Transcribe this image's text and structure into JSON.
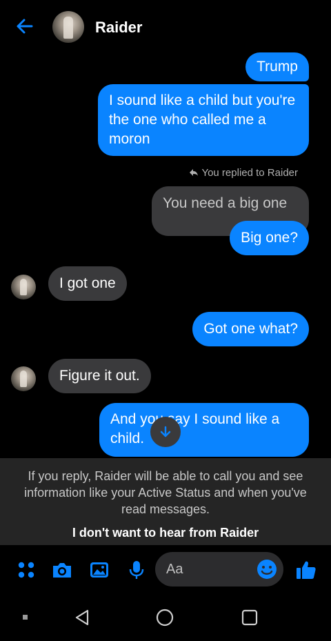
{
  "header": {
    "contact_name": "Raider",
    "back_icon": "arrow-left-icon"
  },
  "messages": [
    {
      "side": "out",
      "text": "Trump"
    },
    {
      "side": "out",
      "text": "I sound like a child but you're the one who called me a moron"
    },
    {
      "type": "reply-note",
      "text": "You replied to Raider"
    },
    {
      "side": "quoted",
      "text": "You need a big one"
    },
    {
      "side": "out",
      "text": "Big one?"
    },
    {
      "side": "in",
      "text": "I got one"
    },
    {
      "side": "out",
      "text": "Got one what?"
    },
    {
      "side": "in",
      "text": "Figure it out."
    },
    {
      "side": "out",
      "text": "And you say I sound like a child."
    }
  ],
  "request_notice": {
    "text": "If you reply, Raider will be able to call you and see information like your Active Status and when you've read messages.",
    "action": "I don't want to hear from Raider"
  },
  "composer": {
    "placeholder": "Aa",
    "icons": [
      "apps-icon",
      "camera-icon",
      "image-icon",
      "microphone-icon",
      "emoji-icon",
      "thumbs-up-icon"
    ]
  },
  "colors": {
    "accent": "#0a84ff",
    "incoming_bubble": "#3a3a3c",
    "background": "#000000"
  }
}
